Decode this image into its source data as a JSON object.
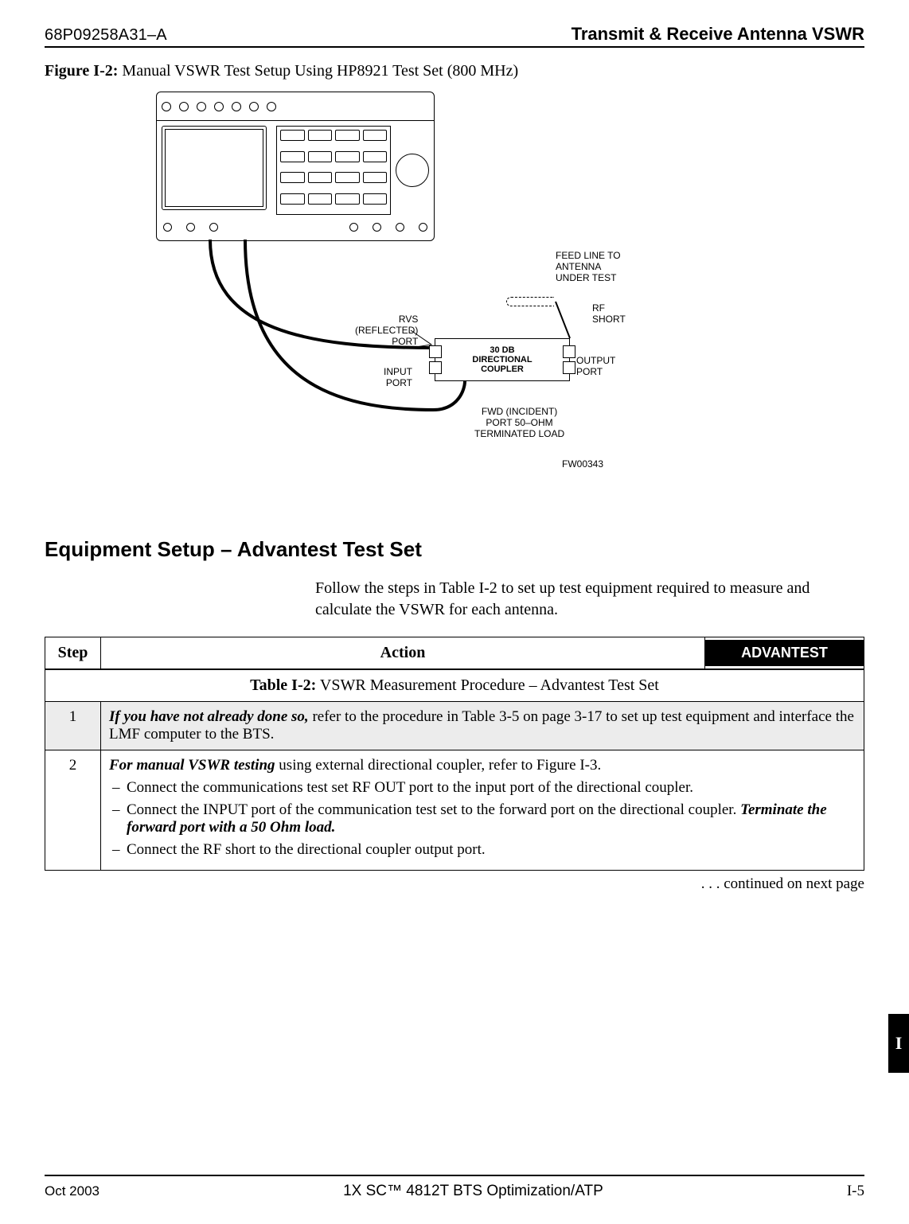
{
  "header": {
    "doc_id": "68P09258A31–A",
    "title": "Transmit & Receive Antenna VSWR"
  },
  "figure": {
    "caption_label": "Figure I-2:",
    "caption_text": " Manual VSWR Test Setup Using HP8921 Test Set (800 MHz)",
    "coupler_label": "30 DB\nDIRECTIONAL\nCOUPLER",
    "labels": {
      "feed": "FEED LINE TO\nANTENNA\nUNDER TEST",
      "rf_short": "RF\nSHORT",
      "rvs": "RVS\n(REFLECTED)\nPORT",
      "input": "INPUT\nPORT",
      "output": "OUTPUT\nPORT",
      "fwd": "FWD (INCIDENT)\nPORT 50–OHM\nTERMINATED LOAD",
      "fw": "FW00343"
    }
  },
  "section_heading": "Equipment Setup – Advantest  Test Set",
  "section_body": "Follow the steps in Table I-2 to set up test equipment required to measure and calculate the VSWR for each antenna.",
  "table": {
    "title_label": "Table I-2:",
    "title_text": " VSWR Measurement Procedure – Advantest Test Set",
    "col_step": "Step",
    "col_action": "Action",
    "badge": "ADVANTEST",
    "rows": [
      {
        "step": "1",
        "lead": "If you have not already done so,",
        "rest": " refer to the procedure in Table 3-5 on page 3-17 to set up test equipment and interface the LMF computer to the BTS."
      },
      {
        "step": "2",
        "lead": "For manual VSWR testing",
        "rest": " using external directional coupler, refer to Figure I-3.",
        "bullets": [
          "Connect the communications test set RF OUT port to the input port of the directional coupler.",
          {
            "pre": "Connect the INPUT port of the communication test set to the forward port on the directional coupler. ",
            "em": "Terminate the forward port with a 50 Ohm load."
          },
          "Connect the RF short to the directional coupler output port."
        ]
      }
    ],
    "continued": ". . . continued on next page"
  },
  "side_tab": "I",
  "footer": {
    "left": "Oct 2003",
    "center": "1X SC™ 4812T BTS Optimization/ATP",
    "right": "I-5"
  }
}
